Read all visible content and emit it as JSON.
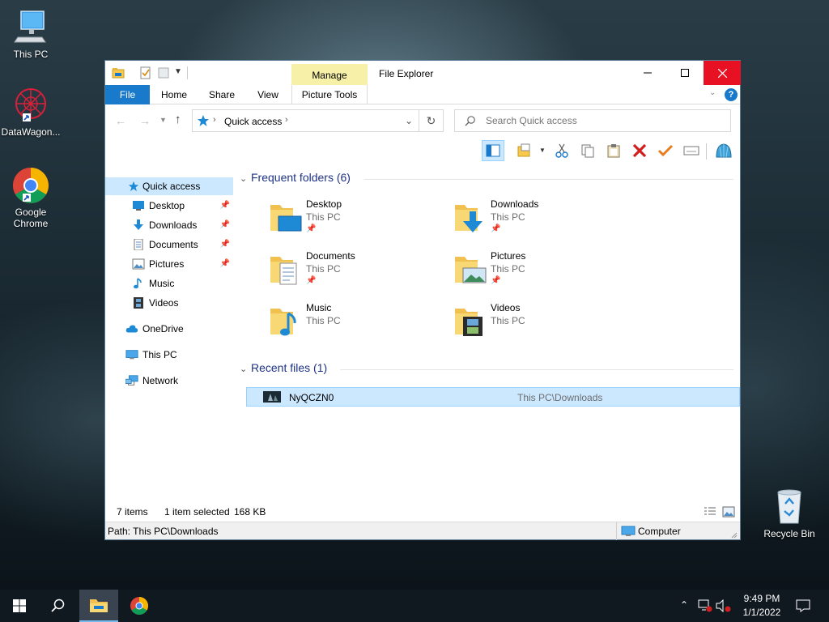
{
  "desktop": {
    "icons": [
      {
        "label": "This PC"
      },
      {
        "label": "DataWagon..."
      },
      {
        "label": "Google Chrome"
      },
      {
        "label": "Recycle Bin"
      }
    ]
  },
  "window": {
    "title": "File Explorer",
    "context_tab_group": "Manage",
    "ribbon_tabs": [
      "File",
      "Home",
      "Share",
      "View",
      "Picture Tools"
    ],
    "address": {
      "location": "Quick access"
    },
    "search": {
      "placeholder": "Search Quick access"
    },
    "sidebar": {
      "items": [
        {
          "label": "Quick access",
          "selected": true
        },
        {
          "label": "Desktop",
          "pinned": true
        },
        {
          "label": "Downloads",
          "pinned": true
        },
        {
          "label": "Documents",
          "pinned": true
        },
        {
          "label": "Pictures",
          "pinned": true
        },
        {
          "label": "Music"
        },
        {
          "label": "Videos"
        },
        {
          "label": "OneDrive"
        },
        {
          "label": "This PC"
        },
        {
          "label": "Network"
        }
      ]
    },
    "frequent": {
      "header": "Frequent folders (6)",
      "folders": [
        {
          "name": "Desktop",
          "location": "This PC",
          "pinned": true
        },
        {
          "name": "Downloads",
          "location": "This PC",
          "pinned": true
        },
        {
          "name": "Documents",
          "location": "This PC",
          "pinned": true
        },
        {
          "name": "Pictures",
          "location": "This PC",
          "pinned": true
        },
        {
          "name": "Music",
          "location": "This PC"
        },
        {
          "name": "Videos",
          "location": "This PC"
        }
      ]
    },
    "recent": {
      "header": "Recent files (1)",
      "files": [
        {
          "name": "NyQCZN0",
          "path": "This PC\\Downloads"
        }
      ]
    },
    "status": {
      "items": "7 items",
      "selected": "1 item selected",
      "size": "168 KB"
    },
    "pathbar": {
      "path": "Path: This PC\\Downloads",
      "zone": "Computer"
    }
  },
  "taskbar": {
    "time": "9:49 PM",
    "date": "1/1/2022"
  },
  "colors": {
    "accent": "#1979ca",
    "close": "#e81123",
    "manage": "#f7f0a8",
    "selection": "#cce8ff"
  }
}
